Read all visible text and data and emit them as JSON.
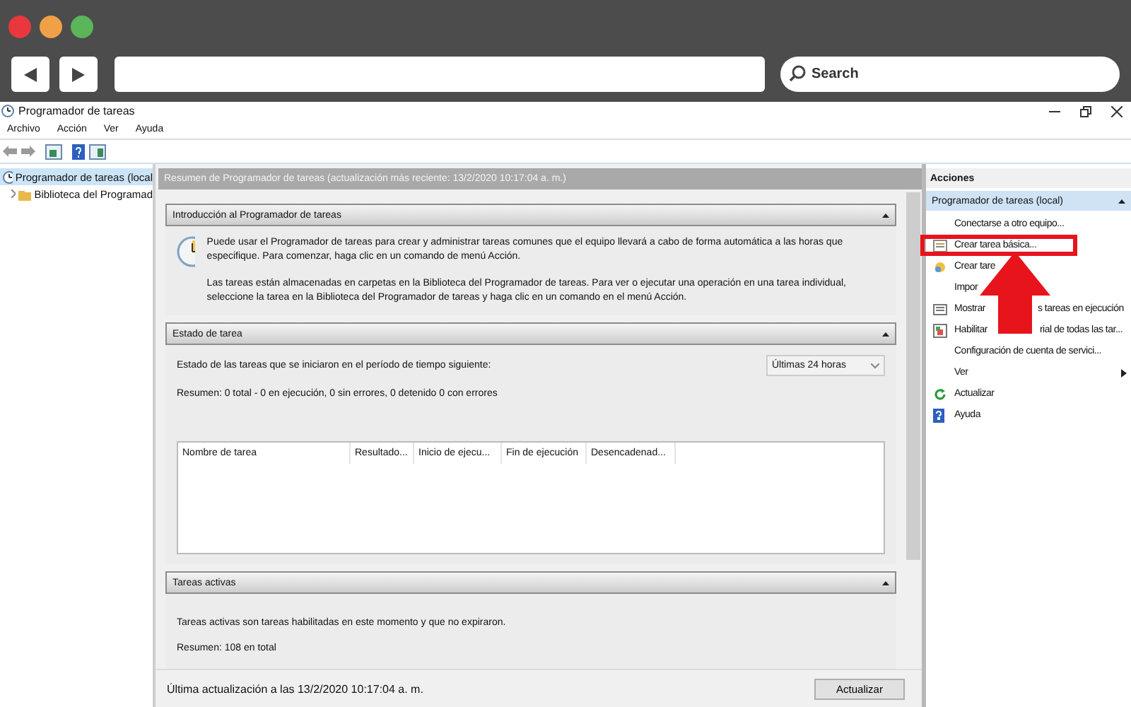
{
  "browser": {
    "search_placeholder": "Search"
  },
  "window": {
    "title": "Programador de tareas"
  },
  "menu": [
    "Archivo",
    "Acción",
    "Ver",
    "Ayuda"
  ],
  "tree": [
    {
      "label": "Programador de tareas (local",
      "selected": true,
      "children": [
        {
          "label": "Biblioteca del Programad",
          "selected": false,
          "expanded": false
        }
      ]
    }
  ],
  "summary_header": "Resumen de Programador de tareas (actualización más reciente: 13/2/2020 10:17:04 a. m.)",
  "sections": [
    {
      "kind": "intro",
      "title": "Introducción al Programador de tareas",
      "expanded": true,
      "paragraphs": [
        "Puede usar el Programador de tareas para crear y administrar tareas comunes que el equipo llevará a cabo de forma automática a las horas que especifique. Para comenzar, haga clic en un comando de menú Acción.",
        "Las tareas están almacenadas en carpetas en la Biblioteca del Programador de tareas. Para ver o ejecutar una operación en una tarea individual, seleccione la tarea en la Biblioteca del Programador de tareas y haga clic en un comando en el menú Acción."
      ]
    },
    {
      "kind": "status",
      "title": "Estado de tarea",
      "expanded": true,
      "prompt": "Estado de las tareas que se iniciaron en el período de tiempo siguiente:",
      "period": "Últimas 24 horas",
      "summary": "Resumen: 0 total - 0 en ejecución, 0 sin errores, 0 detenido  0 con errores",
      "columns": [
        "Nombre de tarea",
        "Resultado...",
        "Inicio de ejecu...",
        "Fin de ejecución",
        "Desencadenad..."
      ]
    },
    {
      "kind": "active",
      "title": "Tareas activas",
      "expanded": true,
      "text": "Tareas activas son tareas habilitadas en este momento y que no expiraron.",
      "summary": "Resumen: 108 en total"
    }
  ],
  "footer": {
    "updated": "Última actualización a las 13/2/2020 10:17:04 a. m.",
    "button": "Actualizar"
  },
  "actions": {
    "title": "Acciones",
    "group": "Programador de tareas (local)",
    "annotation_arrow": true,
    "items": [
      {
        "label": "Conectarse a otro equipo...",
        "kind": "plain",
        "highlighted": false
      },
      {
        "label": "Crear tarea básica...",
        "kind": "wizard",
        "highlighted": true
      },
      {
        "label": "Crear tare",
        "kind": "task",
        "highlighted": false
      },
      {
        "label": "Impor",
        "kind": "plain",
        "highlighted": false
      },
      {
        "label": "Mostrar",
        "label_after": "s tareas en ejecución",
        "kind": "list",
        "highlighted": false
      },
      {
        "label": "Habilitar",
        "label_after": "rial de todas las tar...",
        "kind": "log",
        "highlighted": false
      },
      {
        "label": "Configuración de cuenta de servici...",
        "kind": "plain",
        "highlighted": false
      },
      {
        "label": "Ver",
        "kind": "plain",
        "submenu": true,
        "highlighted": false
      },
      {
        "label": "Actualizar",
        "kind": "refresh",
        "highlighted": false
      },
      {
        "label": "Ayuda",
        "kind": "help",
        "highlighted": false
      }
    ]
  }
}
